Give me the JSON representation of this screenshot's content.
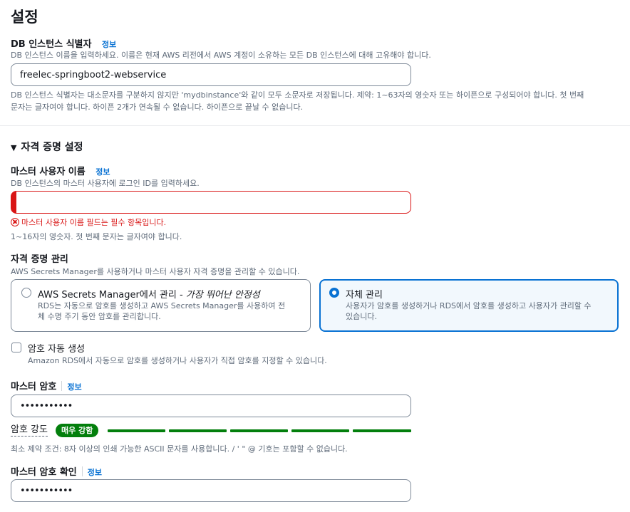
{
  "page_title": "설정",
  "info_label": "정보",
  "db_identifier": {
    "label": "DB 인스턴스 식별자",
    "description": "DB 인스턴스 이름을 입력하세요. 이름은 현재 AWS 리전에서 AWS 계정이 소유하는 모든 DB 인스턴스에 대해 고유해야 합니다.",
    "value": "freelec-springboot2-webservice",
    "constraint_line1": "DB 인스턴스 식별자는 대소문자를 구분하지 않지만 'mydbinstance'와 같이 모두 소문자로 저장됩니다. 제약: 1~63자의 영숫자 또는 하이픈으로 구성되어야 합니다. 첫 번째",
    "constraint_line2": "문자는 글자여야 합니다. 하이픈 2개가 연속될 수 없습니다. 하이픈으로 끝날 수 없습니다."
  },
  "credentials_section": {
    "title": "자격 증명 설정",
    "expand_icon": "caret-down-icon"
  },
  "master_username": {
    "label": "마스터 사용자 이름",
    "description": "DB 인스턴스의 마스터 사용자에 로그인 ID를 입력하세요.",
    "value": "",
    "error": "마스터 사용자 이름 필드는 필수 항목입니다.",
    "constraint": "1~16자의 영숫자. 첫 번째 문자는 글자여야 합니다."
  },
  "credential_management": {
    "label": "자격 증명 관리",
    "description": "AWS Secrets Manager를 사용하거나 마스터 사용자 자격 증명을 관리할 수 있습니다.",
    "options": [
      {
        "title_prefix": "AWS Secrets Manager에서 관리 - ",
        "title_italic": "가장 뛰어난 안정성",
        "desc_line1": "RDS는 자동으로 암호를 생성하고 AWS Secrets Manager를 사용하여 전",
        "desc_line2": "체 수명 주기 동안 암호를 관리합니다.",
        "selected": false
      },
      {
        "title_prefix": "자체 관리",
        "title_italic": "",
        "desc_line1": "사용자가 암호를 생성하거나 RDS에서 암호를 생성하고 사용자가 관리할 수",
        "desc_line2": "있습니다.",
        "selected": true
      }
    ]
  },
  "auto_generate": {
    "label": "암호 자동 생성",
    "description": "Amazon RDS에서 자동으로 암호를 생성하거나 사용자가 직접 암호를 지정할 수 있습니다.",
    "checked": false
  },
  "master_password": {
    "label": "마스터 암호",
    "value": "•••••••••••",
    "strength_label": "암호 강도",
    "strength_badge": "매우 강함",
    "strength_level": 1.0,
    "strength_color": "#037f0c",
    "constraint": "최소 제약 조건: 8자 이상의 인쇄 가능한 ASCII 문자를 사용합니다. / ' \" @ 기호는 포함할 수 없습니다."
  },
  "confirm_password": {
    "label": "마스터 암호 확인",
    "value": "•••••••••••"
  },
  "colors": {
    "link": "#0972d3",
    "error": "#d91515",
    "success": "#037f0c",
    "selected_bg": "#f2f8fd"
  }
}
